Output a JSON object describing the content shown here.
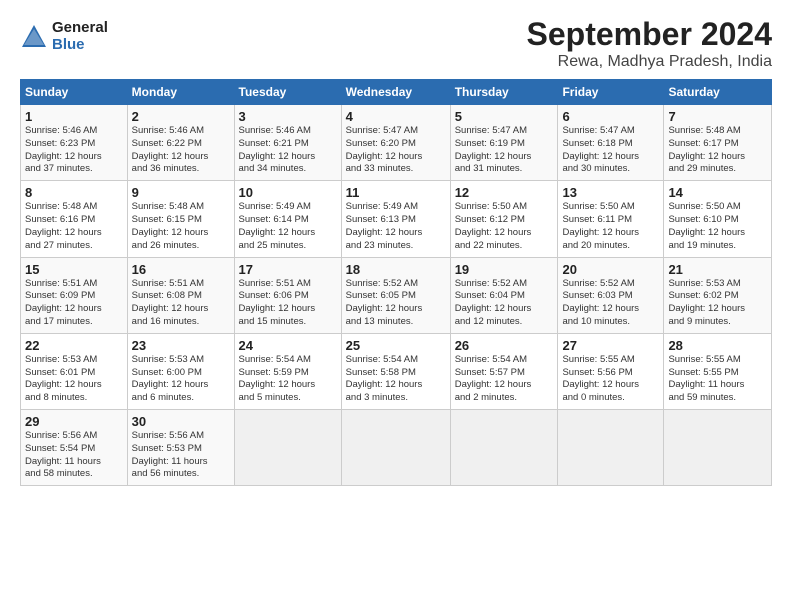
{
  "logo": {
    "general": "General",
    "blue": "Blue"
  },
  "title": "September 2024",
  "subtitle": "Rewa, Madhya Pradesh, India",
  "days_header": [
    "Sunday",
    "Monday",
    "Tuesday",
    "Wednesday",
    "Thursday",
    "Friday",
    "Saturday"
  ],
  "weeks": [
    [
      {
        "num": "1",
        "detail": "Sunrise: 5:46 AM\nSunset: 6:23 PM\nDaylight: 12 hours\nand 37 minutes."
      },
      {
        "num": "2",
        "detail": "Sunrise: 5:46 AM\nSunset: 6:22 PM\nDaylight: 12 hours\nand 36 minutes."
      },
      {
        "num": "3",
        "detail": "Sunrise: 5:46 AM\nSunset: 6:21 PM\nDaylight: 12 hours\nand 34 minutes."
      },
      {
        "num": "4",
        "detail": "Sunrise: 5:47 AM\nSunset: 6:20 PM\nDaylight: 12 hours\nand 33 minutes."
      },
      {
        "num": "5",
        "detail": "Sunrise: 5:47 AM\nSunset: 6:19 PM\nDaylight: 12 hours\nand 31 minutes."
      },
      {
        "num": "6",
        "detail": "Sunrise: 5:47 AM\nSunset: 6:18 PM\nDaylight: 12 hours\nand 30 minutes."
      },
      {
        "num": "7",
        "detail": "Sunrise: 5:48 AM\nSunset: 6:17 PM\nDaylight: 12 hours\nand 29 minutes."
      }
    ],
    [
      {
        "num": "8",
        "detail": "Sunrise: 5:48 AM\nSunset: 6:16 PM\nDaylight: 12 hours\nand 27 minutes."
      },
      {
        "num": "9",
        "detail": "Sunrise: 5:48 AM\nSunset: 6:15 PM\nDaylight: 12 hours\nand 26 minutes."
      },
      {
        "num": "10",
        "detail": "Sunrise: 5:49 AM\nSunset: 6:14 PM\nDaylight: 12 hours\nand 25 minutes."
      },
      {
        "num": "11",
        "detail": "Sunrise: 5:49 AM\nSunset: 6:13 PM\nDaylight: 12 hours\nand 23 minutes."
      },
      {
        "num": "12",
        "detail": "Sunrise: 5:50 AM\nSunset: 6:12 PM\nDaylight: 12 hours\nand 22 minutes."
      },
      {
        "num": "13",
        "detail": "Sunrise: 5:50 AM\nSunset: 6:11 PM\nDaylight: 12 hours\nand 20 minutes."
      },
      {
        "num": "14",
        "detail": "Sunrise: 5:50 AM\nSunset: 6:10 PM\nDaylight: 12 hours\nand 19 minutes."
      }
    ],
    [
      {
        "num": "15",
        "detail": "Sunrise: 5:51 AM\nSunset: 6:09 PM\nDaylight: 12 hours\nand 17 minutes."
      },
      {
        "num": "16",
        "detail": "Sunrise: 5:51 AM\nSunset: 6:08 PM\nDaylight: 12 hours\nand 16 minutes."
      },
      {
        "num": "17",
        "detail": "Sunrise: 5:51 AM\nSunset: 6:06 PM\nDaylight: 12 hours\nand 15 minutes."
      },
      {
        "num": "18",
        "detail": "Sunrise: 5:52 AM\nSunset: 6:05 PM\nDaylight: 12 hours\nand 13 minutes."
      },
      {
        "num": "19",
        "detail": "Sunrise: 5:52 AM\nSunset: 6:04 PM\nDaylight: 12 hours\nand 12 minutes."
      },
      {
        "num": "20",
        "detail": "Sunrise: 5:52 AM\nSunset: 6:03 PM\nDaylight: 12 hours\nand 10 minutes."
      },
      {
        "num": "21",
        "detail": "Sunrise: 5:53 AM\nSunset: 6:02 PM\nDaylight: 12 hours\nand 9 minutes."
      }
    ],
    [
      {
        "num": "22",
        "detail": "Sunrise: 5:53 AM\nSunset: 6:01 PM\nDaylight: 12 hours\nand 8 minutes."
      },
      {
        "num": "23",
        "detail": "Sunrise: 5:53 AM\nSunset: 6:00 PM\nDaylight: 12 hours\nand 6 minutes."
      },
      {
        "num": "24",
        "detail": "Sunrise: 5:54 AM\nSunset: 5:59 PM\nDaylight: 12 hours\nand 5 minutes."
      },
      {
        "num": "25",
        "detail": "Sunrise: 5:54 AM\nSunset: 5:58 PM\nDaylight: 12 hours\nand 3 minutes."
      },
      {
        "num": "26",
        "detail": "Sunrise: 5:54 AM\nSunset: 5:57 PM\nDaylight: 12 hours\nand 2 minutes."
      },
      {
        "num": "27",
        "detail": "Sunrise: 5:55 AM\nSunset: 5:56 PM\nDaylight: 12 hours\nand 0 minutes."
      },
      {
        "num": "28",
        "detail": "Sunrise: 5:55 AM\nSunset: 5:55 PM\nDaylight: 11 hours\nand 59 minutes."
      }
    ],
    [
      {
        "num": "29",
        "detail": "Sunrise: 5:56 AM\nSunset: 5:54 PM\nDaylight: 11 hours\nand 58 minutes."
      },
      {
        "num": "30",
        "detail": "Sunrise: 5:56 AM\nSunset: 5:53 PM\nDaylight: 11 hours\nand 56 minutes."
      },
      {
        "num": "",
        "detail": ""
      },
      {
        "num": "",
        "detail": ""
      },
      {
        "num": "",
        "detail": ""
      },
      {
        "num": "",
        "detail": ""
      },
      {
        "num": "",
        "detail": ""
      }
    ]
  ]
}
